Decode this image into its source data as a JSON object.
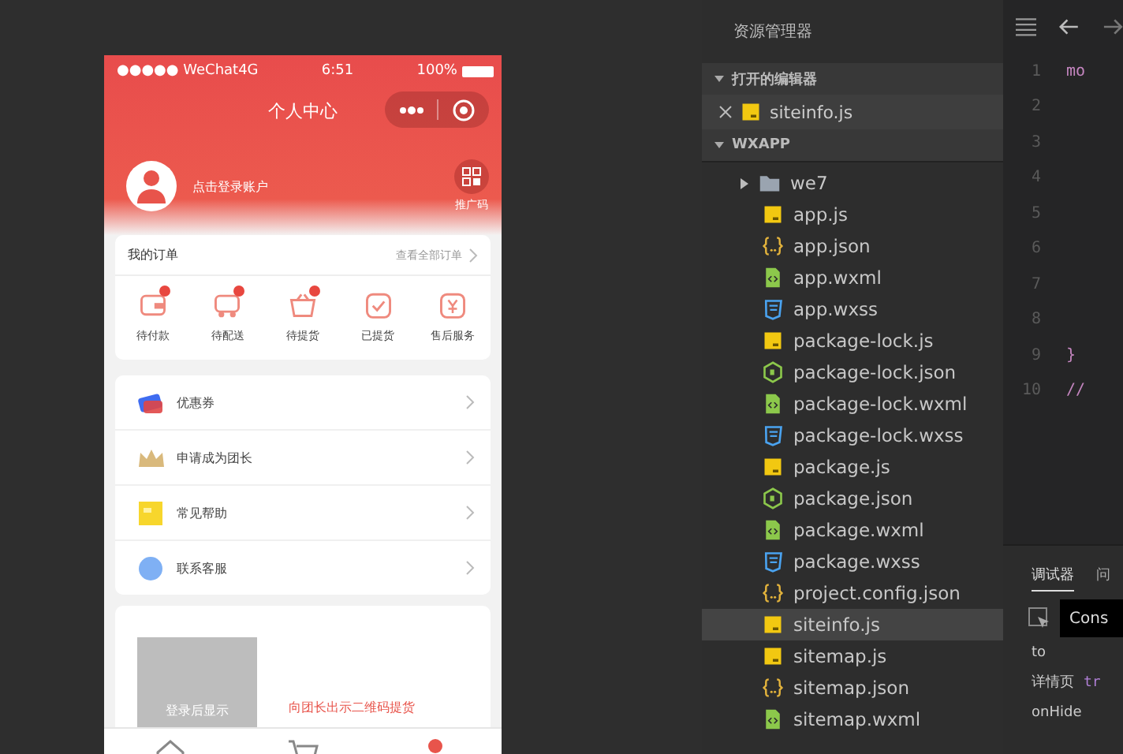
{
  "simulator": {
    "status_bar": {
      "carrier": "●●●●● WeChat4G",
      "time": "6:51",
      "battery": "100%"
    },
    "nav_title": "个人中心",
    "profile": {
      "login_text": "点击登录账户",
      "qr_label": "推广码"
    },
    "orders": {
      "title": "我的订单",
      "view_all": "查看全部订单",
      "items": [
        {
          "label": "待付款",
          "kind": "wallet",
          "badge": true
        },
        {
          "label": "待配送",
          "kind": "truck",
          "badge": true
        },
        {
          "label": "待提货",
          "kind": "basket",
          "badge": true
        },
        {
          "label": "已提货",
          "kind": "done",
          "badge": false
        },
        {
          "label": "售后服务",
          "kind": "service",
          "badge": false
        }
      ]
    },
    "menu": [
      {
        "label": "优惠券",
        "kind": "coupon"
      },
      {
        "label": "申请成为团长",
        "kind": "crown"
      },
      {
        "label": "常见帮助",
        "kind": "help"
      },
      {
        "label": "联系客服",
        "kind": "contact"
      }
    ],
    "pickup_card": {
      "placeholder": "登录后显示",
      "hint": "向团长出示二维码提货"
    },
    "tab_bar": [
      {
        "kind": "home",
        "selected": false
      },
      {
        "kind": "cart",
        "selected": false
      },
      {
        "kind": "user",
        "selected": true
      }
    ]
  },
  "explorer": {
    "title": "资源管理器",
    "open_editors": {
      "label": "打开的编辑器",
      "expanded": true,
      "files": [
        {
          "name": "siteinfo.js",
          "kind": "js"
        }
      ]
    },
    "project": {
      "label": "WXAPP",
      "expanded": true,
      "items": [
        {
          "name": "we7",
          "kind": "folder",
          "expanded": false,
          "selected": false
        },
        {
          "name": "app.js",
          "kind": "js",
          "selected": false
        },
        {
          "name": "app.json",
          "kind": "json",
          "selected": false
        },
        {
          "name": "app.wxml",
          "kind": "wxml",
          "selected": false
        },
        {
          "name": "app.wxss",
          "kind": "wxss",
          "selected": false
        },
        {
          "name": "package-lock.js",
          "kind": "js",
          "selected": false
        },
        {
          "name": "package-lock.json",
          "kind": "node",
          "selected": false
        },
        {
          "name": "package-lock.wxml",
          "kind": "wxml",
          "selected": false
        },
        {
          "name": "package-lock.wxss",
          "kind": "wxss",
          "selected": false
        },
        {
          "name": "package.js",
          "kind": "js",
          "selected": false
        },
        {
          "name": "package.json",
          "kind": "node",
          "selected": false
        },
        {
          "name": "package.wxml",
          "kind": "wxml",
          "selected": false
        },
        {
          "name": "package.wxss",
          "kind": "wxss",
          "selected": false
        },
        {
          "name": "project.config.json",
          "kind": "json",
          "selected": false
        },
        {
          "name": "siteinfo.js",
          "kind": "js",
          "selected": true
        },
        {
          "name": "sitemap.js",
          "kind": "js",
          "selected": false
        },
        {
          "name": "sitemap.json",
          "kind": "json",
          "selected": false
        },
        {
          "name": "sitemap.wxml",
          "kind": "wxml",
          "selected": false
        }
      ]
    }
  },
  "editor": {
    "lines": [
      {
        "number": "1",
        "code": "mo"
      },
      {
        "number": "2"
      },
      {
        "number": "3"
      },
      {
        "number": "4"
      },
      {
        "number": "5"
      },
      {
        "number": "6"
      },
      {
        "number": "7"
      },
      {
        "number": "8"
      },
      {
        "number": "9",
        "code": "}"
      },
      {
        "number": "10",
        "code": "//"
      }
    ]
  },
  "debugger": {
    "tabs": [
      {
        "label": "调试器",
        "selected": true
      },
      {
        "label": "问",
        "selected": false
      }
    ],
    "console_tab": "Cons",
    "rows": [
      {
        "text": "to"
      },
      {
        "text": "详情页",
        "code": "tr"
      },
      {
        "text": "onHide"
      }
    ]
  }
}
